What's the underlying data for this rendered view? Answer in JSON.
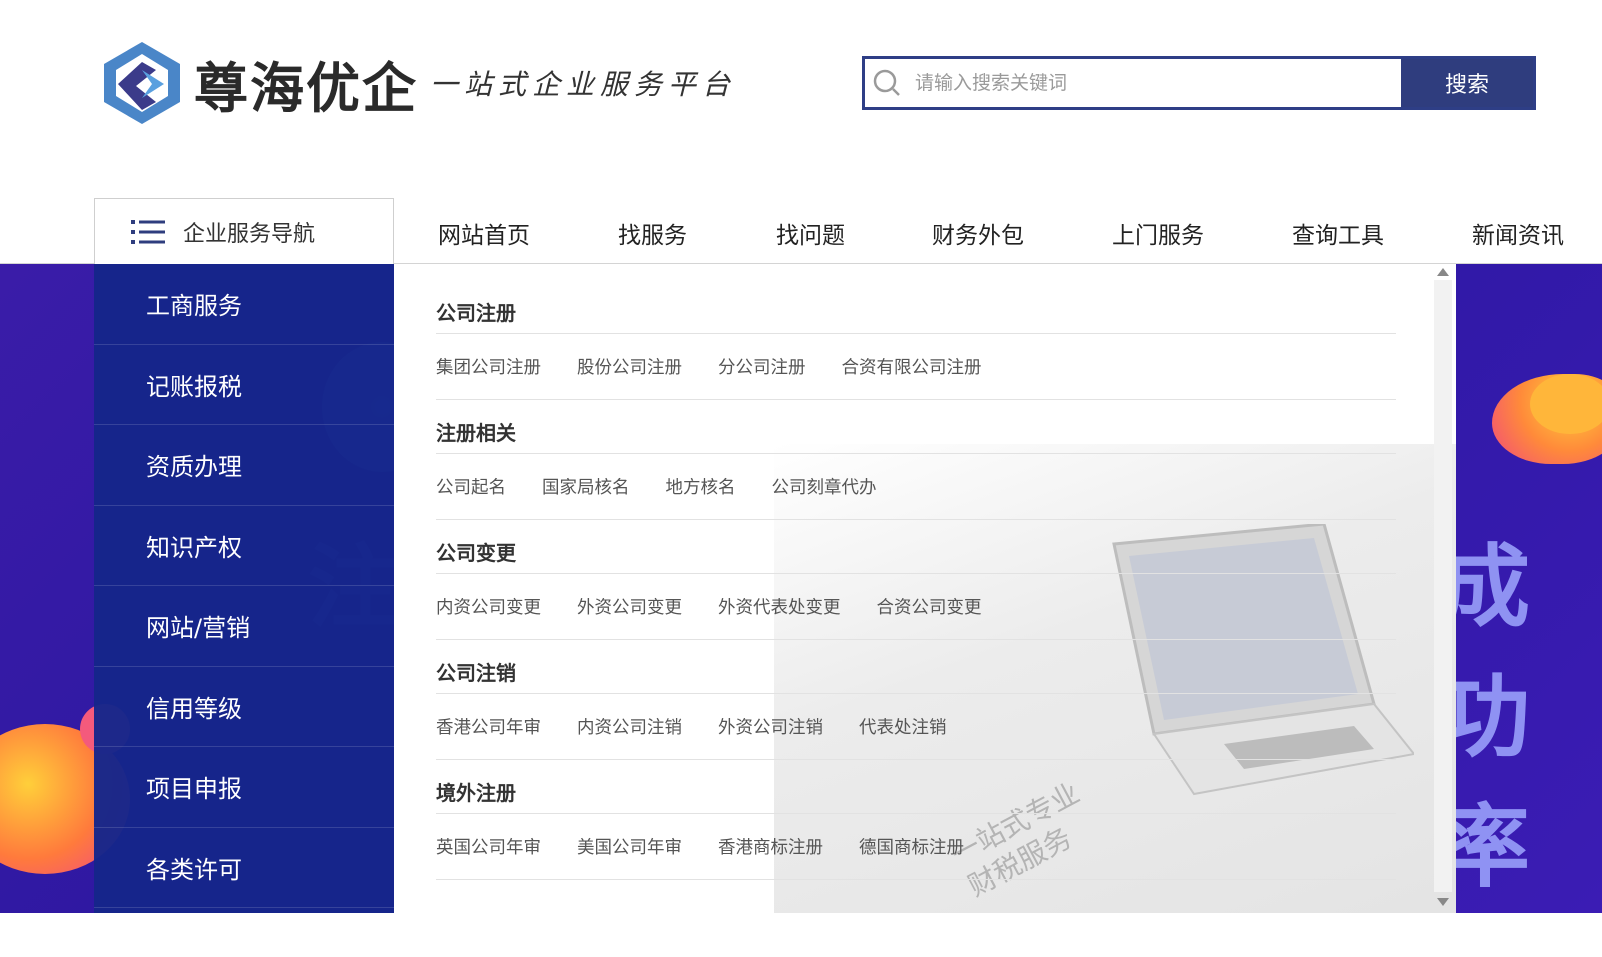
{
  "header": {
    "logo_name": "尊海优企",
    "logo_slogan": "一站式企业服务平台",
    "search_placeholder": "请输入搜索关键词",
    "search_button": "搜索"
  },
  "category_nav": {
    "title": "企业服务导航"
  },
  "main_nav": [
    "网站首页",
    "找服务",
    "找问题",
    "财务外包",
    "上门服务",
    "查询工具",
    "新闻资讯"
  ],
  "side_menu": [
    "工商服务",
    "记账报税",
    "资质办理",
    "知识产权",
    "网站/营销",
    "信用等级",
    "项目申报",
    "各类许可"
  ],
  "dropdown": {
    "groups": [
      {
        "title": "公司注册",
        "links": [
          "集团公司注册",
          "股份公司注册",
          "分公司注册",
          "合资有限公司注册"
        ]
      },
      {
        "title": "注册相关",
        "links": [
          "公司起名",
          "国家局核名",
          "地方核名",
          "公司刻章代办"
        ]
      },
      {
        "title": "公司变更",
        "links": [
          "内资公司变更",
          "外资公司变更",
          "外资代表处变更",
          "合资公司变更"
        ]
      },
      {
        "title": "公司注销",
        "links": [
          "香港公司年审",
          "内资公司注销",
          "外资公司注销",
          "代表处注销"
        ]
      },
      {
        "title": "境外注册",
        "links": [
          "英国公司年审",
          "美国公司年审",
          "香港商标注册",
          "德国商标注册"
        ]
      }
    ],
    "watermark_line1": "一站式专业",
    "watermark_line2": "财税服务"
  },
  "banner": {
    "left_word": "注",
    "right_word": "成功率"
  },
  "colors": {
    "brand_navy": "#2f3d7e",
    "side_menu_bg": "#16268a",
    "banner_purple": "#2b17a0"
  }
}
